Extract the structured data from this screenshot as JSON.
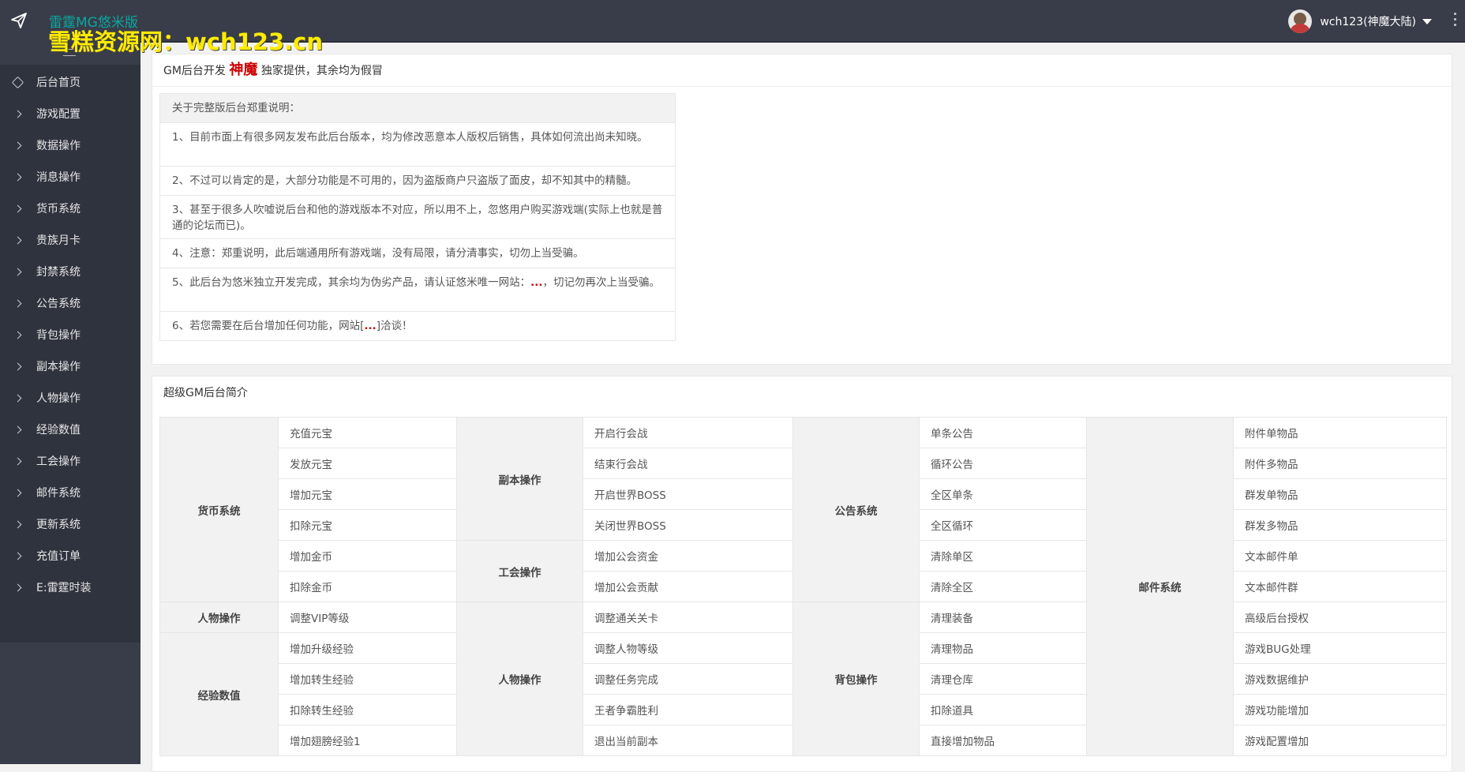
{
  "header": {
    "brand": "雷霆MG悠米版",
    "watermark": "雪糕资源网：wch123.cn",
    "user": "wch123(神魔大陆)"
  },
  "sidebar": {
    "items": [
      {
        "label": "后台首页",
        "icon": "home-icon"
      },
      {
        "label": "游戏配置",
        "icon": "chevron-right-icon"
      },
      {
        "label": "数据操作",
        "icon": "chevron-right-icon"
      },
      {
        "label": "消息操作",
        "icon": "chevron-right-icon"
      },
      {
        "label": "货币系统",
        "icon": "chevron-right-icon"
      },
      {
        "label": "贵族月卡",
        "icon": "chevron-right-icon"
      },
      {
        "label": "封禁系统",
        "icon": "chevron-right-icon"
      },
      {
        "label": "公告系统",
        "icon": "chevron-right-icon"
      },
      {
        "label": "背包操作",
        "icon": "chevron-right-icon"
      },
      {
        "label": "副本操作",
        "icon": "chevron-right-icon"
      },
      {
        "label": "人物操作",
        "icon": "chevron-right-icon"
      },
      {
        "label": "经验数值",
        "icon": "chevron-right-icon"
      },
      {
        "label": "工会操作",
        "icon": "chevron-right-icon"
      },
      {
        "label": "邮件系统",
        "icon": "chevron-right-icon"
      },
      {
        "label": "更新系统",
        "icon": "chevron-right-icon"
      },
      {
        "label": "充值订单",
        "icon": "chevron-right-icon"
      },
      {
        "label": "E:雷霆时装",
        "icon": "chevron-right-icon"
      }
    ]
  },
  "notice_card": {
    "head_pre": "GM后台开发",
    "head_strong": "神魔",
    "head_post": "独家提供，其余均为假冒",
    "title": "关于完整版后台郑重说明：",
    "rows": [
      "1、目前市面上有很多网友发布此后台版本，均为修改恶意本人版权后销售，具体如何流出尚未知晓。",
      "2、不过可以肯定的是，大部分功能是不可用的，因为盗版商户只盗版了面皮，却不知其中的精髓。",
      "3、甚至于很多人吹嘘说后台和他的游戏版本不对应，所以用不上，忽悠用户购买游戏端(实际上也就是普通的论坛而已)。",
      "4、注意：郑重说明，此后端通用所有游戏端，没有局限，请分清事实，切勿上当受骗。"
    ],
    "row5_pre": "5、此后台为悠米独立开发完成，其余均为伪劣产品，请认证悠米唯一网站：",
    "row5_dots": "...",
    "row5_post": "，切记勿再次上当受骗。",
    "row6_pre": "6、若您需要在后台增加任何功能，网站[",
    "row6_dots": "...",
    "row6_post": "]洽谈！"
  },
  "intro_card": {
    "title": "超级GM后台简介",
    "cats": {
      "currency": "货币系统",
      "character_a": "人物操作",
      "exp": "经验数值",
      "dungeon": "副本操作",
      "guild": "工会操作",
      "character_b": "人物操作",
      "notice": "公告系统",
      "bag": "背包操作",
      "mail": "邮件系统"
    },
    "col1": [
      "充值元宝",
      "发放元宝",
      "增加元宝",
      "扣除元宝",
      "增加金币",
      "扣除金币",
      "调整VIP等级",
      "增加升级经验",
      "增加转生经验",
      "扣除转生经验",
      "增加翅膀经验1"
    ],
    "col2": [
      "开启行会战",
      "结束行会战",
      "开启世界BOSS",
      "关闭世界BOSS",
      "增加公会资金",
      "增加公会贡献",
      "调整通关关卡",
      "调整人物等级",
      "调整任务完成",
      "王者争霸胜利",
      "退出当前副本"
    ],
    "col3": [
      "单条公告",
      "循环公告",
      "全区单条",
      "全区循环",
      "清除单区",
      "清除全区",
      "清理装备",
      "清理物品",
      "清理仓库",
      "扣除道具",
      "直接增加物品"
    ],
    "col4": [
      "附件单物品",
      "附件多物品",
      "群发单物品",
      "群发多物品",
      "文本邮件单",
      "文本邮件群",
      "高级后台授权",
      "游戏BUG处理",
      "游戏数据维护",
      "游戏功能增加",
      "游戏配置增加"
    ]
  }
}
